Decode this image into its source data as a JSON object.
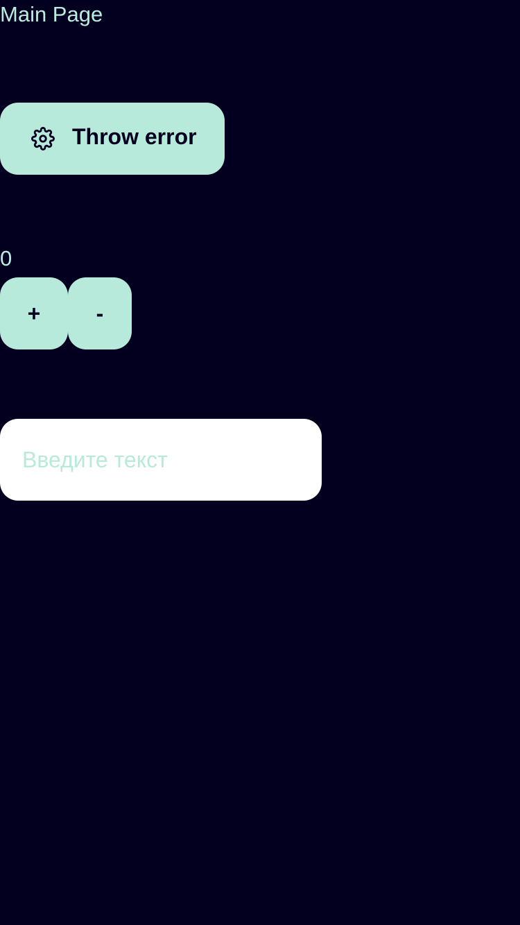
{
  "header": {
    "title": "Main Page"
  },
  "error_button": {
    "label": "Throw error",
    "icon": "gear-icon"
  },
  "counter": {
    "value": "0",
    "increment_label": "+",
    "decrement_label": "-"
  },
  "text_input": {
    "value": "",
    "placeholder": "Введите текст"
  },
  "colors": {
    "background": "#02001e",
    "accent": "#b8eadb",
    "text": "#bcece0",
    "input_background": "#ffffff"
  }
}
